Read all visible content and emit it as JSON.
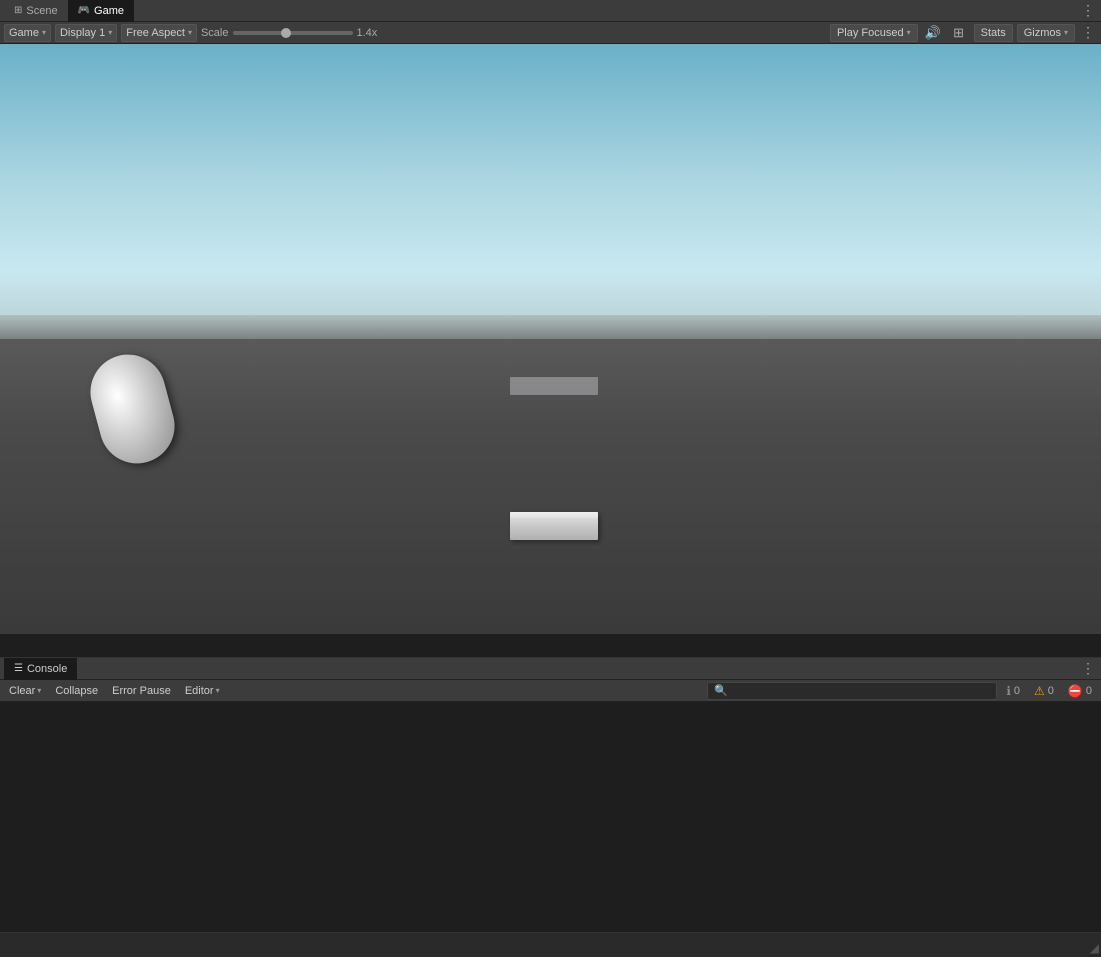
{
  "tabs": {
    "scene": {
      "label": "Scene",
      "icon": "⊞"
    },
    "game": {
      "label": "Game",
      "icon": "🎮"
    }
  },
  "toolbar": {
    "game_dropdown": "Game",
    "display_dropdown": "Display 1",
    "aspect_dropdown": "Free Aspect",
    "scale_label": "Scale",
    "scale_value": "1.4x",
    "play_focused": "Play Focused",
    "stats_label": "Stats",
    "gizmos_label": "Gizmos",
    "more_icon": "⋮"
  },
  "console": {
    "tab_icon": "☰",
    "tab_label": "Console",
    "clear_label": "Clear",
    "collapse_label": "Collapse",
    "error_pause_label": "Error Pause",
    "editor_label": "Editor",
    "search_placeholder": "",
    "badge_info_count": "0",
    "badge_warning_count": "0",
    "badge_error_count": "0",
    "more_icon": "⋮"
  }
}
